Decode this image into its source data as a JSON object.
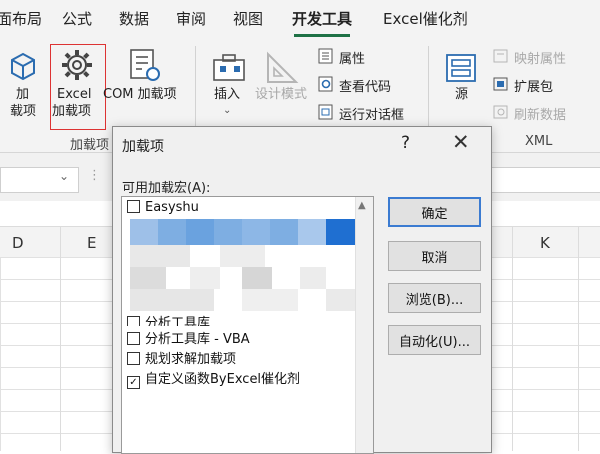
{
  "ribbon": {
    "tabs": [
      {
        "label": "面布局"
      },
      {
        "label": "公式"
      },
      {
        "label": "数据"
      },
      {
        "label": "审阅"
      },
      {
        "label": "视图"
      },
      {
        "label": "开发工具"
      },
      {
        "label": "Excel催化剂"
      }
    ],
    "addins_group": {
      "add_line1": "加",
      "add_line2": "载项",
      "excel_line1": "Excel",
      "excel_line2": "加载项",
      "com": "COM 加载项",
      "group_label": "加载项"
    },
    "controls_group": {
      "insert": "插入",
      "design_mode": "设计模式",
      "properties": "属性",
      "view_code": "查看代码",
      "run_dialog": "运行对话框"
    },
    "xml_group": {
      "source": "源",
      "map_properties": "映射属性",
      "expansion_pack": "扩展包",
      "refresh_data": "刷新数据",
      "group_label": "XML"
    }
  },
  "sheet": {
    "columns": [
      "D",
      "E",
      "K"
    ]
  },
  "dialog": {
    "title": "加载项",
    "help": "?",
    "close": "✕",
    "available_label": "可用加载宏(A):",
    "items": [
      {
        "label": "Easyshu",
        "checked": false
      },
      {
        "label": "分析工具库",
        "checked": false
      },
      {
        "label": "分析工具库 - VBA",
        "checked": false
      },
      {
        "label": "规划求解加载项",
        "checked": false
      },
      {
        "label": "自定义函数ByExcel催化剂",
        "checked": true
      }
    ],
    "buttons": {
      "ok": "确定",
      "cancel": "取消",
      "browse": "浏览(B)...",
      "automation": "自动化(U)..."
    }
  },
  "colors": {
    "accent": "#1e7145",
    "selection": "#7eaee2",
    "highlight_box": "#dd3333"
  }
}
